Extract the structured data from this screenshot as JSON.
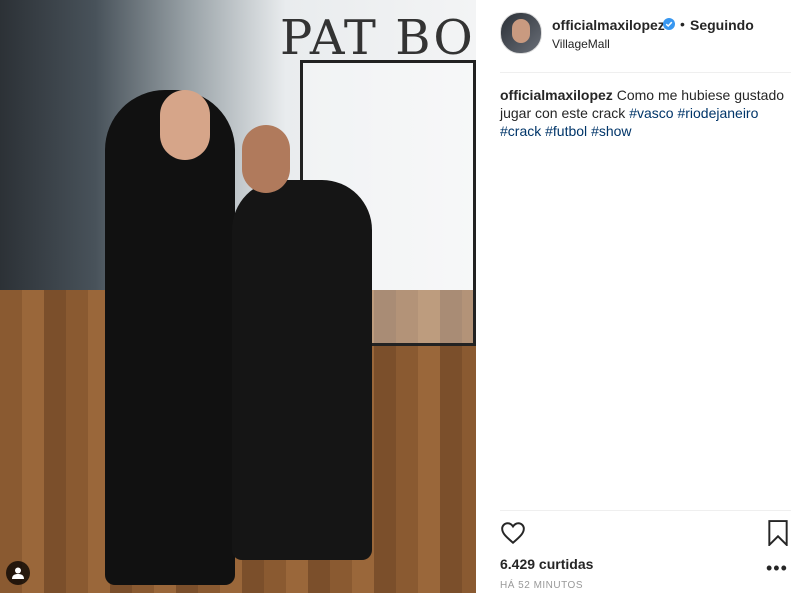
{
  "post": {
    "image_alt": "",
    "header": {
      "username": "officialmaxilopez",
      "separator": "•",
      "follow_label": "Seguindo",
      "location": "VillageMall"
    },
    "caption": {
      "username": "officialmaxilopez",
      "text": "Como me hubiese gustado jugar con este crack",
      "hashtags": [
        "#vasco",
        "#riodejaneiro",
        "#crack",
        "#futbol",
        "#show"
      ]
    },
    "likes": "6.429 curtidas",
    "time_ago": "HÁ 52 MINUTOS"
  },
  "colors": {
    "verified": "#3897f0",
    "hashtag": "#003569",
    "divider": "#efefef"
  },
  "icons": {
    "verified": "verified-badge-icon",
    "like": "heart-icon",
    "save": "bookmark-icon",
    "more": "more-options-icon",
    "tagged": "user-tag-icon"
  }
}
